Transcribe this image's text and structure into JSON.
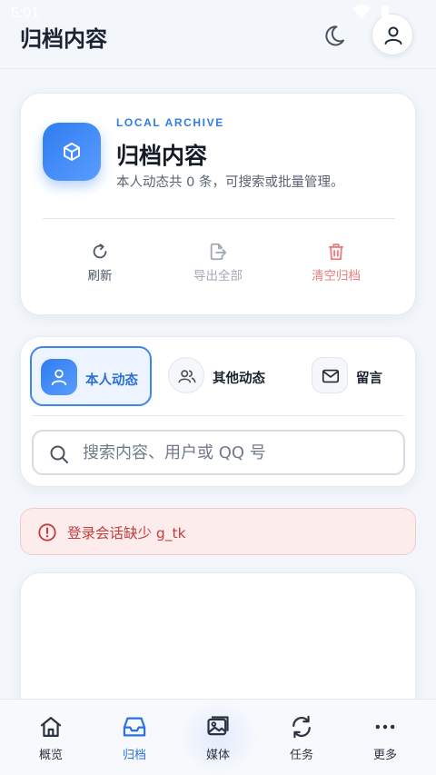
{
  "status_bar": {
    "time": "5:01"
  },
  "header": {
    "title": "归档内容",
    "theme_icon": "moon-icon",
    "account_icon": "user-icon"
  },
  "hero": {
    "icon": "cube-icon",
    "kicker": "LOCAL ARCHIVE",
    "title": "归档内容",
    "description": "本人动态共 0 条，可搜索或批量管理。",
    "actions": [
      {
        "label": "刷新",
        "icon": "refresh-icon"
      },
      {
        "label": "导出全部",
        "icon": "export-icon"
      },
      {
        "label": "清空归档",
        "icon": "trash-icon"
      }
    ]
  },
  "filters": {
    "tabs": [
      {
        "label": "本人动态",
        "icon": "user-icon",
        "selected": true
      },
      {
        "label": "其他动态",
        "icon": "users-icon",
        "selected": false
      },
      {
        "label": "留言",
        "icon": "mail-icon",
        "selected": false
      }
    ],
    "search": {
      "placeholder": "搜索内容、用户或 QQ 号",
      "value": ""
    }
  },
  "error": {
    "message": "登录会话缺少 g_tk"
  },
  "bottom_nav": [
    {
      "label": "概览",
      "icon": "home-icon",
      "active": false
    },
    {
      "label": "归档",
      "icon": "inbox-icon",
      "active": true
    },
    {
      "label": "媒体",
      "icon": "image-icon",
      "active": false
    },
    {
      "label": "任务",
      "icon": "sync-icon",
      "active": false
    },
    {
      "label": "更多",
      "icon": "more-icon",
      "active": false
    }
  ],
  "colors": {
    "accent": "#2f7be8",
    "danger": "#c53c3c",
    "background": "#f3f6fa"
  }
}
